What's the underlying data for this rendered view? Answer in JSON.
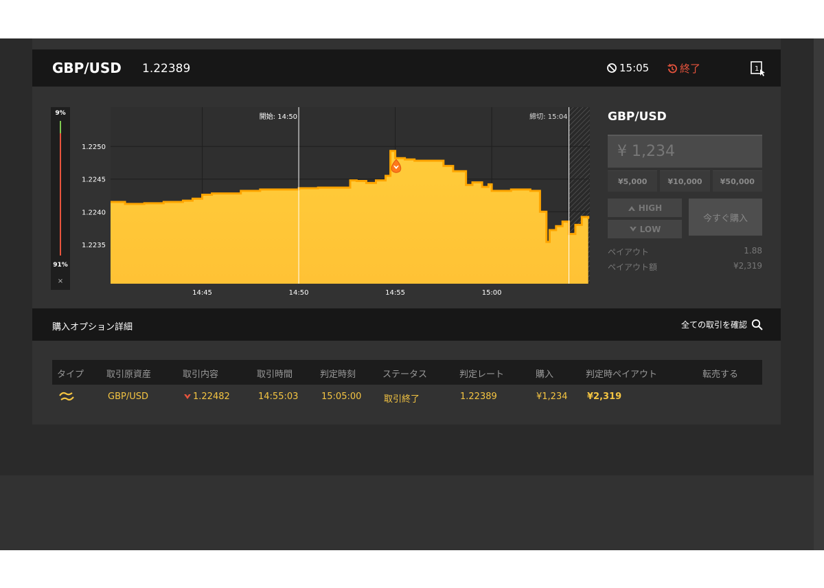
{
  "header": {
    "pair": "GBP/USD",
    "rate": "1.22389",
    "time_left": "15:05",
    "status": "終了"
  },
  "gauge": {
    "top_pct": "9%",
    "bottom_pct": "91%",
    "high_fraction": 0.09,
    "close": "×"
  },
  "chart_data": {
    "type": "area",
    "y_ticks": [
      "1.2250",
      "1.2245",
      "1.2240",
      "1.2235"
    ],
    "x_ticks": [
      "14:45",
      "14:50",
      "14:55",
      "15:00"
    ],
    "start_label": "開始: 14:50",
    "end_label": "締切: 15:04",
    "ylim": [
      1.2229,
      1.2256
    ],
    "xlim": [
      "14:40:15",
      "15:05:05"
    ],
    "series": [
      {
        "x": [
          "14:40:15",
          "14:41:00",
          "14:42:00",
          "14:43:00",
          "14:44:00",
          "14:44:30",
          "14:45:00",
          "14:45:30",
          "14:46:00",
          "14:47:00",
          "14:48:00",
          "14:49:00",
          "14:50:00",
          "14:51:00",
          "14:52:00",
          "14:52:40",
          "14:53:00",
          "14:53:30",
          "14:54:00",
          "14:54:30",
          "14:54:45",
          "14:55:00",
          "14:55:30",
          "14:56:00",
          "14:57:00",
          "14:57:30",
          "14:58:00",
          "14:58:40",
          "14:59:00",
          "14:59:30",
          "14:59:50",
          "15:00:00",
          "15:01:00",
          "15:02:00",
          "15:02:30",
          "15:02:50",
          "15:03:00",
          "15:03:20",
          "15:03:40",
          "15:04:00",
          "15:04:20",
          "15:04:40",
          "15:05:00"
        ],
        "values": [
          1.22415,
          1.22412,
          1.22413,
          1.22415,
          1.22417,
          1.2242,
          1.22426,
          1.22428,
          1.22428,
          1.22432,
          1.22434,
          1.22434,
          1.22436,
          1.22437,
          1.22437,
          1.22448,
          1.22447,
          1.22444,
          1.22448,
          1.22455,
          1.22493,
          1.22482,
          1.2248,
          1.22478,
          1.22478,
          1.2247,
          1.22462,
          1.22441,
          1.22445,
          1.22438,
          1.22442,
          1.22432,
          1.22434,
          1.22432,
          1.224,
          1.22354,
          1.22372,
          1.22378,
          1.22385,
          1.22366,
          1.2238,
          1.22392,
          1.22389
        ]
      }
    ],
    "entry": {
      "x": "14:55:03",
      "value": 1.22482
    },
    "grid": true
  },
  "trade": {
    "pair": "GBP/USD",
    "amount": "¥ 1,234",
    "quick_amounts": [
      "¥5,000",
      "¥10,000",
      "¥50,000"
    ],
    "high": "HIGH",
    "low": "LOW",
    "buy_now": "今すぐ購入",
    "payout_label": "ペイアウト",
    "payout": "1.88",
    "payout_amount_label": "ペイアウト額",
    "payout_amount": "¥2,319"
  },
  "details": {
    "title": "購入オプション詳細",
    "all_trades": "全ての取引を確認",
    "headers": [
      "タイプ",
      "取引原資産",
      "取引内容",
      "取引時間",
      "判定時刻",
      "ステータス",
      "判定レート",
      "購入",
      "判定時ペイアウト",
      "転売する"
    ],
    "row": {
      "asset": "GBP/USD",
      "content": "1.22482",
      "trade_time": "14:55:03",
      "judge_time": "15:05:00",
      "status": "取引終了",
      "judge_rate": "1.22389",
      "purchase": "¥1,234",
      "payout": "¥2,319"
    }
  },
  "colors": {
    "accent": "#f5c542",
    "area_top": "#ffa500",
    "area_fill": "#ffc83c",
    "danger": "#e8543d",
    "high_bar": "#7ec850"
  }
}
